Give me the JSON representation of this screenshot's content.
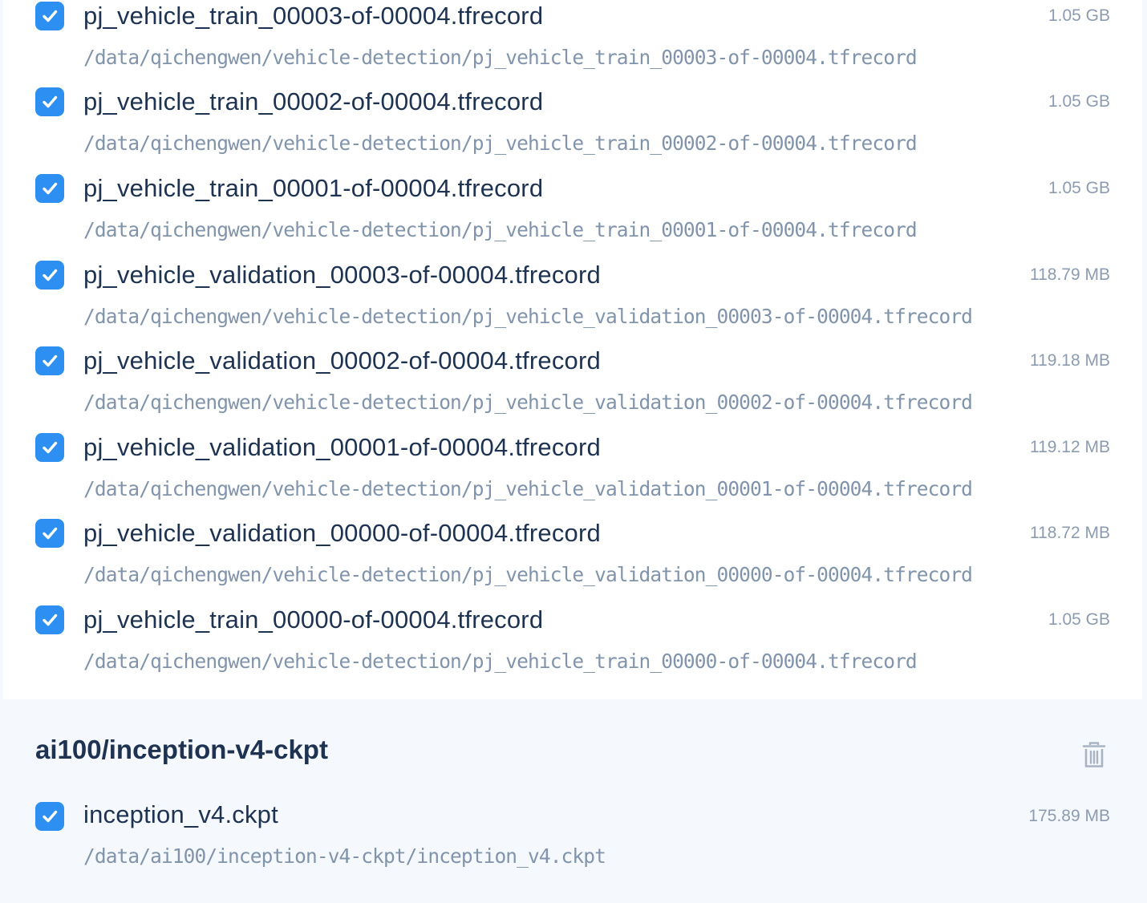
{
  "files_top": [
    {
      "name": "pj_vehicle_train_00003-of-00004.tfrecord",
      "path": "/data/qichengwen/vehicle-detection/pj_vehicle_train_00003-of-00004.tfrecord",
      "size": "1.05 GB",
      "checked": true
    },
    {
      "name": "pj_vehicle_train_00002-of-00004.tfrecord",
      "path": "/data/qichengwen/vehicle-detection/pj_vehicle_train_00002-of-00004.tfrecord",
      "size": "1.05 GB",
      "checked": true
    },
    {
      "name": "pj_vehicle_train_00001-of-00004.tfrecord",
      "path": "/data/qichengwen/vehicle-detection/pj_vehicle_train_00001-of-00004.tfrecord",
      "size": "1.05 GB",
      "checked": true
    },
    {
      "name": "pj_vehicle_validation_00003-of-00004.tfrecord",
      "path": "/data/qichengwen/vehicle-detection/pj_vehicle_validation_00003-of-00004.tfrecord",
      "size": "118.79 MB",
      "checked": true
    },
    {
      "name": "pj_vehicle_validation_00002-of-00004.tfrecord",
      "path": "/data/qichengwen/vehicle-detection/pj_vehicle_validation_00002-of-00004.tfrecord",
      "size": "119.18 MB",
      "checked": true
    },
    {
      "name": "pj_vehicle_validation_00001-of-00004.tfrecord",
      "path": "/data/qichengwen/vehicle-detection/pj_vehicle_validation_00001-of-00004.tfrecord",
      "size": "119.12 MB",
      "checked": true
    },
    {
      "name": "pj_vehicle_validation_00000-of-00004.tfrecord",
      "path": "/data/qichengwen/vehicle-detection/pj_vehicle_validation_00000-of-00004.tfrecord",
      "size": "118.72 MB",
      "checked": true
    },
    {
      "name": "pj_vehicle_train_00000-of-00004.tfrecord",
      "path": "/data/qichengwen/vehicle-detection/pj_vehicle_train_00000-of-00004.tfrecord",
      "size": "1.05 GB",
      "checked": true
    }
  ],
  "group": {
    "title": "ai100/inception-v4-ckpt",
    "delete_icon": "trash-icon",
    "files": [
      {
        "name": "inception_v4.ckpt",
        "path": "/data/ai100/inception-v4-ckpt/inception_v4.ckpt",
        "size": "175.89 MB",
        "checked": true
      }
    ]
  },
  "colors": {
    "accent": "#2e8ff2",
    "title_text": "#1e3352",
    "path_text": "#8194ab",
    "size_text": "#8d9bb0",
    "panel_bg": "#f5f8fc"
  },
  "icons": {
    "checkbox": "checkmark-icon",
    "delete": "trash-icon"
  }
}
